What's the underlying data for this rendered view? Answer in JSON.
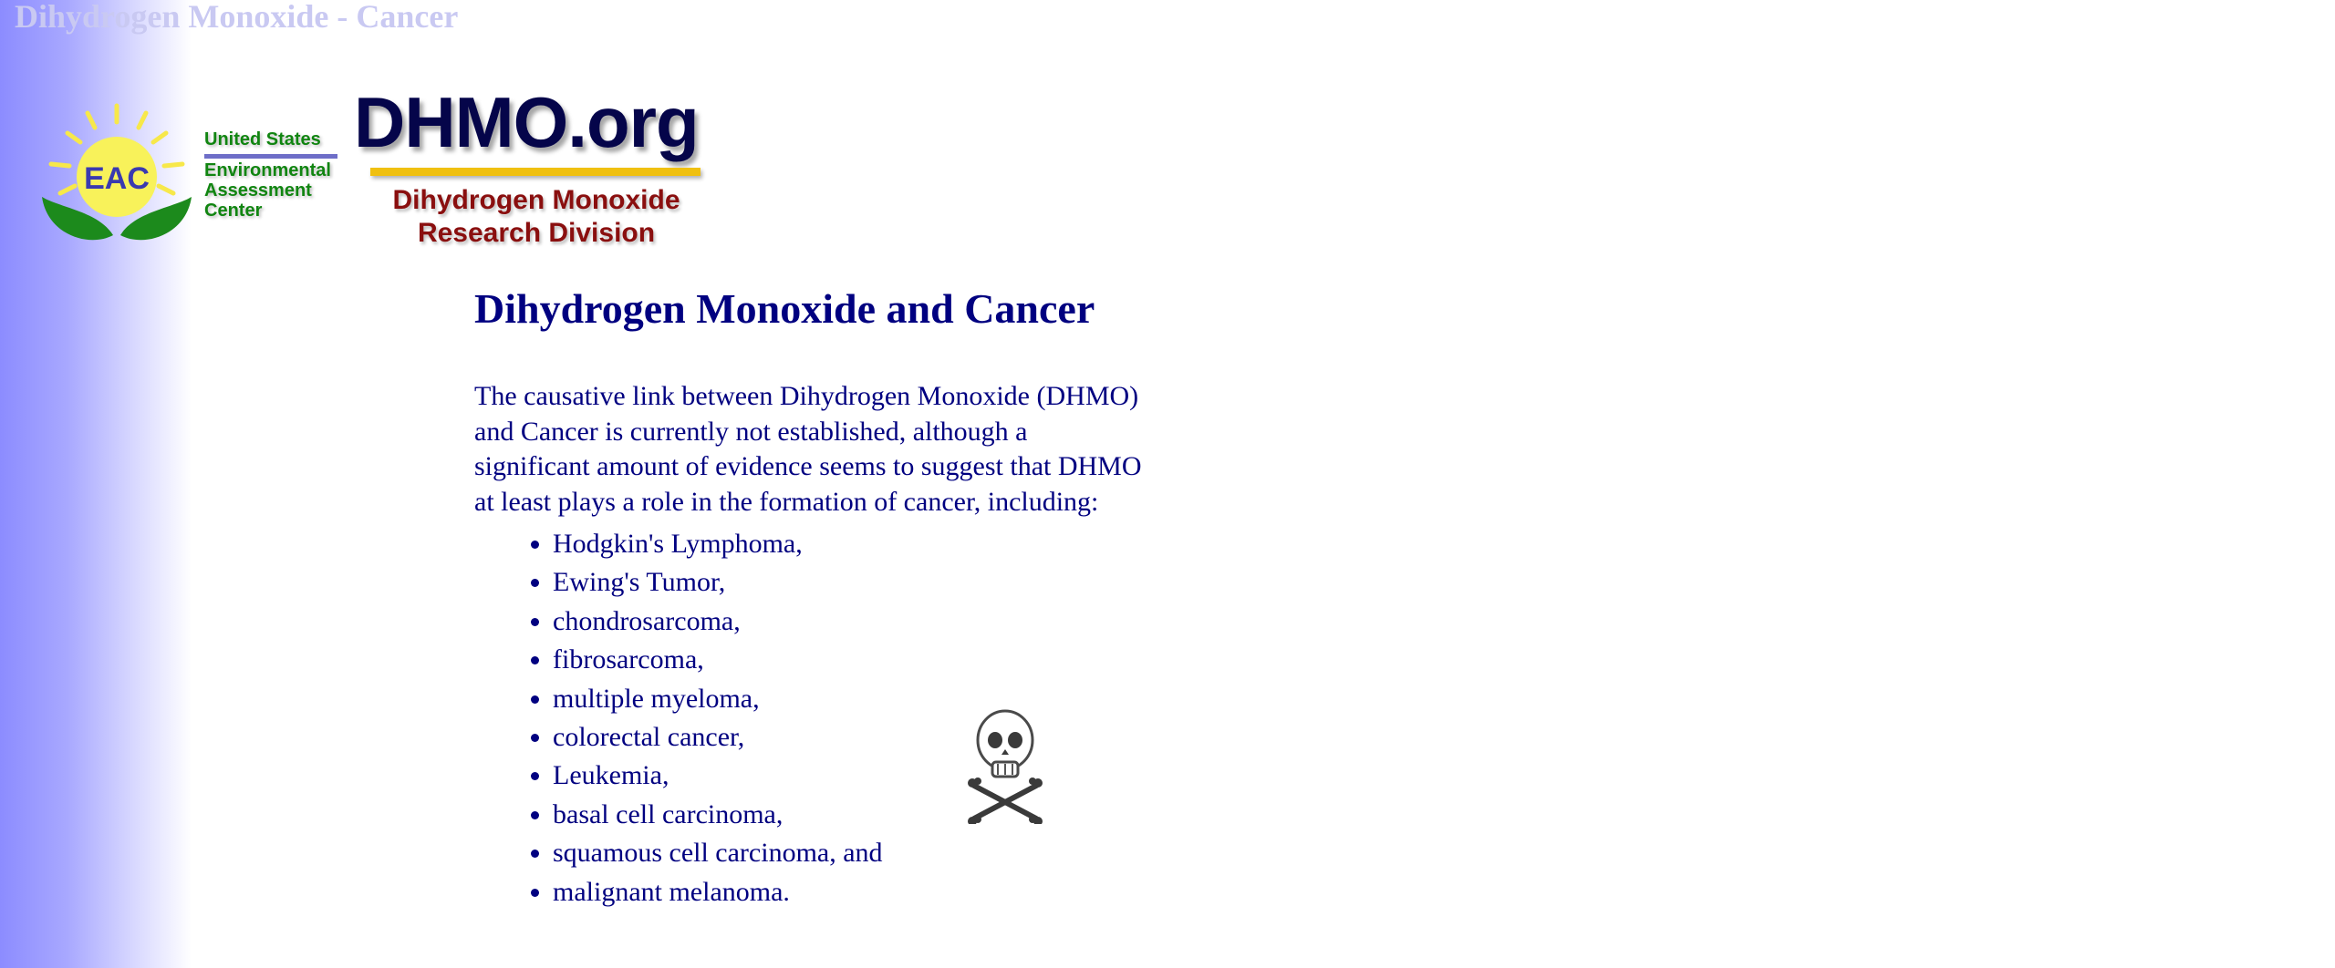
{
  "page": {
    "ghost_title": "Dihydrogen Monoxide - Cancer"
  },
  "logos": {
    "eac": {
      "badge": "EAC",
      "line1": "United States",
      "line2": "Environmental",
      "line3": "Assessment",
      "line4": "Center"
    },
    "dhmo": {
      "wordmark": "DHMO.org",
      "sub_line1": "Dihydrogen Monoxide",
      "sub_line2": "Research Division"
    }
  },
  "article": {
    "heading": "Dihydrogen Monoxide and Cancer",
    "intro": "The causative link between Dihydrogen Monoxide (DHMO) and Cancer is currently not established, although a significant amount of evidence seems to suggest that DHMO at least plays a role in the formation of cancer, including:",
    "cancers": [
      "Hodgkin's Lymphoma,",
      "Ewing's Tumor,",
      "chondrosarcoma,",
      "fibrosarcoma,",
      "multiple myeloma,",
      "colorectal cancer,",
      "Leukemia,",
      "basal cell carcinoma,",
      "squamous cell carcinoma, and",
      "malignant melanoma."
    ]
  },
  "colors": {
    "text": "#000080",
    "sidebar_gradient_start": "#8c8cff",
    "eac_green": "#118511",
    "dhmo_navy": "#05054a",
    "dhmo_red": "#8a0f0f",
    "accent_yellow": "#f0c010"
  },
  "icons": {
    "skull": "skull-and-crossbones-icon",
    "sun": "sun-icon",
    "leaves": "leaves-icon"
  }
}
